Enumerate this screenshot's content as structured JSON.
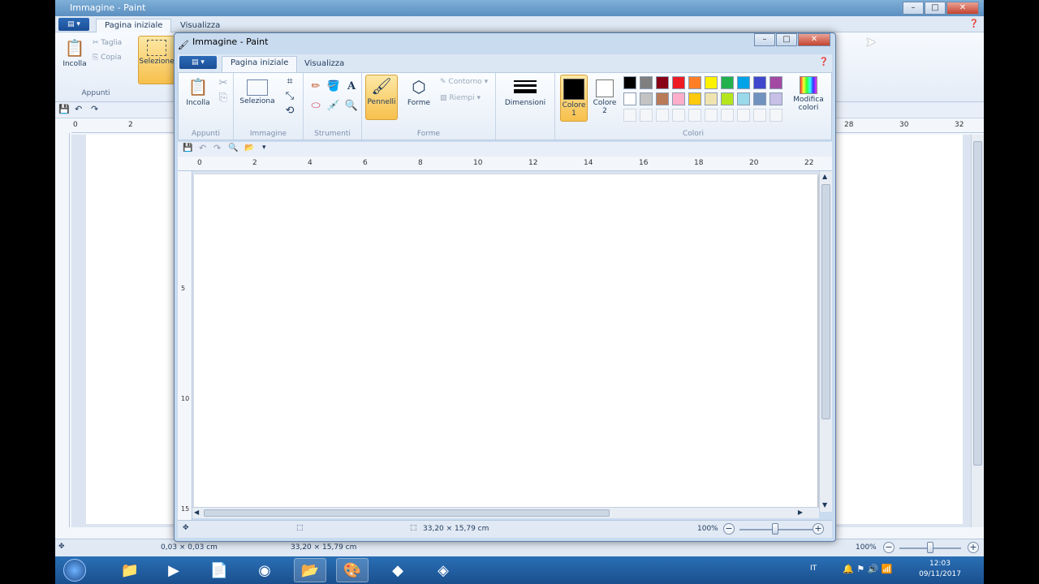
{
  "back_window": {
    "title": "Immagine - Paint",
    "tabs": [
      "Pagina iniziale",
      "Visualizza"
    ],
    "groups": {
      "appunti": "Appunti"
    },
    "buttons": {
      "incolla": "Incolla",
      "taglia": "Taglia",
      "copia": "Copia",
      "selezione": "Selezione"
    },
    "ruler_top": [
      "0",
      "2",
      "28",
      "30",
      "32"
    ],
    "status": {
      "position": "0,03 × 0,03 cm",
      "size": "33,20 × 15,79 cm",
      "zoom": "100%"
    }
  },
  "front_window": {
    "title": "Immagine - Paint",
    "tabs": [
      "Pagina iniziale",
      "Visualizza"
    ],
    "groups": {
      "appunti": "Appunti",
      "immagine": "Immagine",
      "strumenti": "Strumenti",
      "forme": "Forme",
      "colori": "Colori"
    },
    "buttons": {
      "incolla": "Incolla",
      "seleziona": "Seleziona",
      "pennelli": "Pennelli",
      "forme": "Forme",
      "contorno": "Contorno",
      "riempi": "Riempi",
      "dimensioni": "Dimensioni",
      "colore1": "Colore 1",
      "colore2": "Colore 2",
      "modifica_colori": "Modifica colori"
    },
    "ruler_top": [
      "0",
      "2",
      "4",
      "6",
      "8",
      "10",
      "12",
      "14",
      "16",
      "18",
      "20",
      "22"
    ],
    "ruler_left": [
      "5",
      "10",
      "15"
    ],
    "status": {
      "size": "33,20 × 15,79 cm",
      "zoom": "100%"
    }
  },
  "palette_row1": [
    "#000000",
    "#7f7f7f",
    "#880015",
    "#ed1c24",
    "#ff7f27",
    "#fff200",
    "#22b14c",
    "#00a2e8",
    "#3f48cc",
    "#a349a4"
  ],
  "palette_row2": [
    "#ffffff",
    "#c3c3c3",
    "#b97a57",
    "#ffaec9",
    "#ffc90e",
    "#efe4b0",
    "#b5e61d",
    "#99d9ea",
    "#7092be",
    "#c8bfe7"
  ],
  "selected_colors": {
    "color1": "#000000",
    "color2": "#ffffff"
  },
  "taskbar": {
    "time": "12:03",
    "date": "09/11/2017",
    "lang": "IT"
  }
}
